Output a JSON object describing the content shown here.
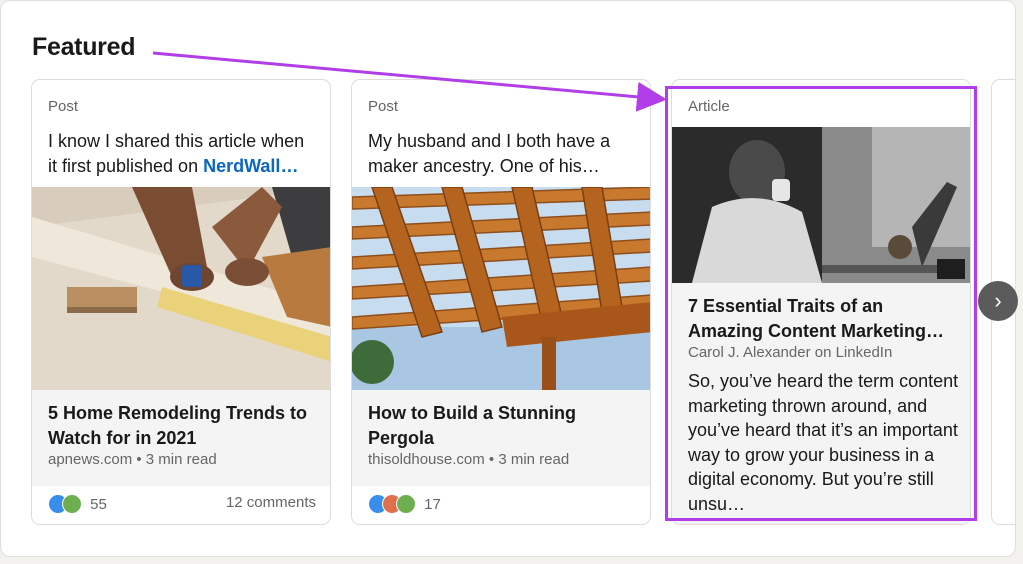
{
  "section": {
    "title": "Featured"
  },
  "cards": [
    {
      "kind": "Post",
      "snippet_pre": "I know I shared this article when it first published on ",
      "snippet_link": "NerdWall…",
      "title": "5 Home Remodeling Trends to Watch for in 2021",
      "meta": "apnews.com • 3 min read",
      "reaction_count": "55",
      "comments": "12 comments",
      "reaction_icons": [
        "like-icon",
        "support-icon"
      ]
    },
    {
      "kind": "Post",
      "snippet": "My husband and I both have a maker ancestry. One of his…",
      "title": "How to Build a Stunning Pergola",
      "meta": "thisoldhouse.com • 3 min read",
      "reaction_count": "17",
      "reaction_icons": [
        "like-icon",
        "celebrate-icon",
        "support-icon"
      ]
    },
    {
      "kind": "Article",
      "title": "7 Essential Traits of an Amazing Content Marketing…",
      "byline": "Carol J. Alexander on LinkedIn",
      "body": "So, you’ve heard the term content marketing thrown around, and you’ve heard that it’s an important way to grow your business in a digital economy. But you’re still unsu…"
    }
  ],
  "next_button": {
    "glyph": "›",
    "icon": "chevron-right-icon"
  },
  "annotation": {
    "color": "#b13ee8"
  },
  "colors": {
    "link": "#0a66c2",
    "like": "#378fe9",
    "celebrate": "#df704d",
    "support": "#6dae4f"
  }
}
